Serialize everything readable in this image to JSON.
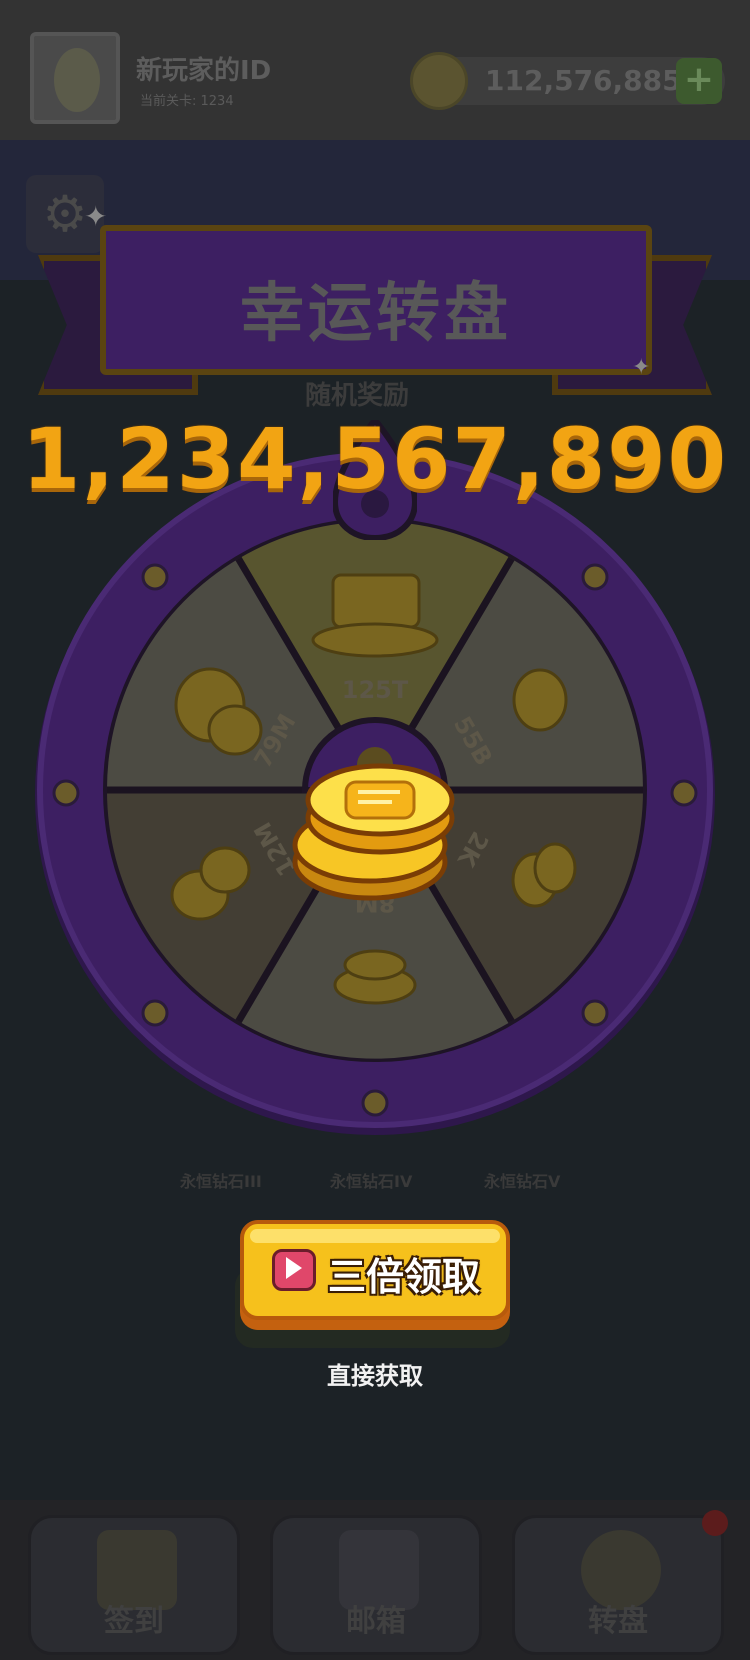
{
  "header": {
    "player_name": "新玩家的ID",
    "level_text": "当前关卡: 1234",
    "coins": "112,576,885",
    "plus_label": "+"
  },
  "popup": {
    "title": "幸运转盘",
    "ghost_label": "随机奖励",
    "big_number": "1,234,567,890"
  },
  "wheel": {
    "segments": [
      {
        "label": "125T",
        "icon": "treasure-chest-icon"
      },
      {
        "label": "55B",
        "icon": "gold-coin-icon"
      },
      {
        "label": "2K",
        "icon": "gold-coins-icon"
      },
      {
        "label": "8M",
        "icon": "gold-coin-pile-icon"
      },
      {
        "label": "12M",
        "icon": "gold-coin-stack-icon"
      },
      {
        "label": "79M",
        "icon": "gold-coin-pile-icon"
      }
    ]
  },
  "chests": [
    {
      "label": "永恒钻石III"
    },
    {
      "label": "永恒钻石IV"
    },
    {
      "label": "永恒钻石V"
    }
  ],
  "actions": {
    "triple_claim": "三倍领取",
    "direct_claim": "直接获取"
  },
  "tabs": [
    {
      "label": "签到",
      "icon": "checkin-icon"
    },
    {
      "label": "邮箱",
      "icon": "mail-icon"
    },
    {
      "label": "转盘",
      "icon": "wheel-icon"
    }
  ],
  "colors": {
    "accent_gold": "#f2a413",
    "wheel_purple": "#3d1f62",
    "cta_yellow": "#f6c11c"
  }
}
